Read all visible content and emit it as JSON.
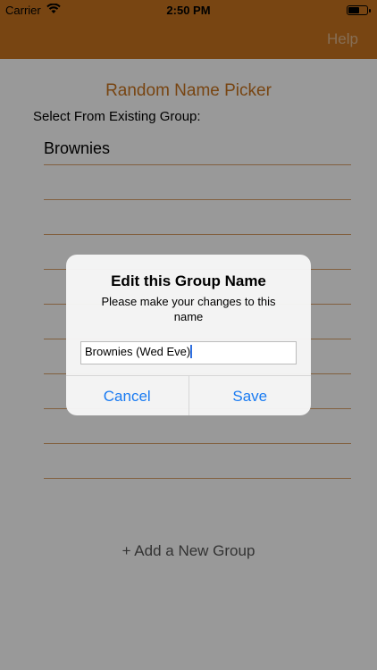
{
  "status_bar": {
    "carrier": "Carrier",
    "time": "2:50 PM",
    "battery_level": 0.6
  },
  "nav": {
    "help_label": "Help"
  },
  "main": {
    "title": "Random Name Picker",
    "select_label": "Select From Existing Group:",
    "groups": [
      "Brownies",
      "",
      "",
      "",
      "",
      "",
      "",
      "",
      "",
      ""
    ],
    "add_group_label": "+ Add a New Group"
  },
  "dialog": {
    "title": "Edit this Group Name",
    "message": "Please make your changes to this name",
    "input_value": "Brownies (Wed Eve)",
    "cancel_label": "Cancel",
    "save_label": "Save"
  },
  "colors": {
    "brand": "#c8741f",
    "accent": "#1a7bf2"
  }
}
